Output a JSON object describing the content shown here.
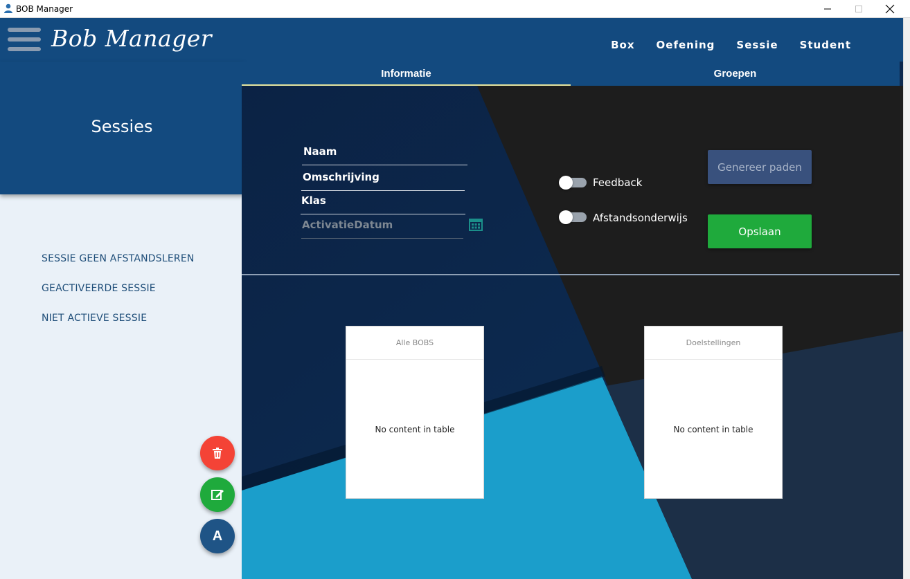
{
  "window": {
    "title": "BOB Manager"
  },
  "header": {
    "brand": "Bob Manager",
    "nav": [
      "Box",
      "Oefening",
      "Sessie",
      "Student"
    ]
  },
  "sidebar": {
    "title": "Sessies",
    "items": [
      "SESSIE GEEN AFSTANDSLEREN",
      "GEACTIVEERDE SESSIE",
      "NIET ACTIEVE SESSIE"
    ],
    "fab_a_label": "A"
  },
  "tabs": [
    "Informatie",
    "Groepen"
  ],
  "form": {
    "naam_label": "Naam",
    "omschrijving_label": "Omschrijving",
    "klas_label": "Klas",
    "activatiedatum_placeholder": "ActivatieDatum",
    "feedback_label": "Feedback",
    "afstandsonderwijs_label": "Afstandsonderwijs",
    "generate_label": "Genereer paden",
    "save_label": "Opslaan"
  },
  "tables": [
    {
      "header": "Alle BOBS",
      "empty_text": "No content in table"
    },
    {
      "header": "Doelstellingen",
      "empty_text": "No content in table"
    }
  ],
  "colors": {
    "header_blue": "#134a7f",
    "save_green": "#1faa3c",
    "delete_red": "#f44336",
    "sidebar_bg": "#eaf1f8"
  }
}
